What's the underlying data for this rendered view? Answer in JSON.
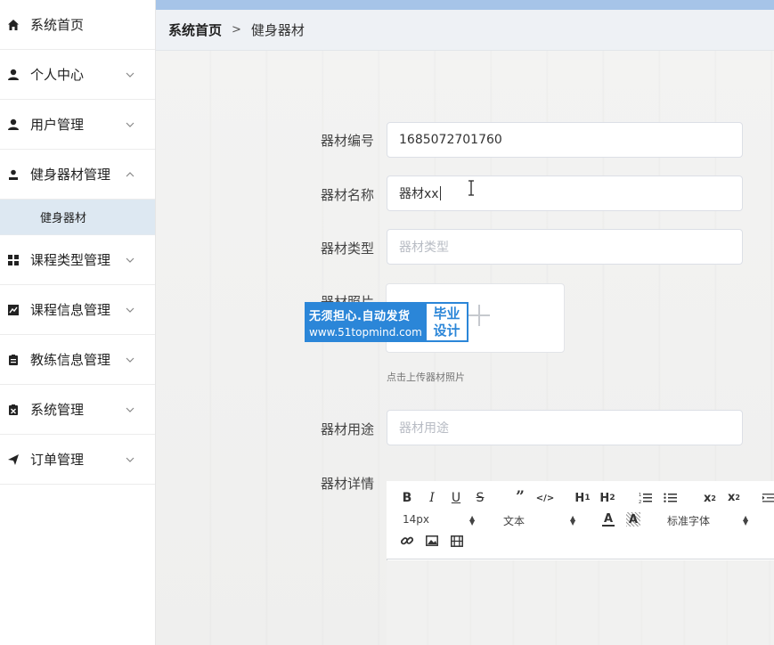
{
  "sidebar": {
    "items": [
      {
        "label": "系统首页",
        "icon": "home-icon",
        "expandable": false
      },
      {
        "label": "个人中心",
        "icon": "person-icon",
        "expandable": true
      },
      {
        "label": "用户管理",
        "icon": "person-icon",
        "expandable": true
      },
      {
        "label": "健身器材管理",
        "icon": "person-small-icon",
        "expandable": true,
        "expanded": true
      },
      {
        "label": "课程类型管理",
        "icon": "grid-icon",
        "expandable": true
      },
      {
        "label": "课程信息管理",
        "icon": "chart-icon",
        "expandable": true
      },
      {
        "label": "教练信息管理",
        "icon": "clipboard-icon",
        "expandable": true
      },
      {
        "label": "系统管理",
        "icon": "clipboard-x-icon",
        "expandable": true
      },
      {
        "label": "订单管理",
        "icon": "send-icon",
        "expandable": true
      }
    ],
    "subitem": {
      "label": "健身器材"
    }
  },
  "breadcrumb": {
    "home": "系统首页",
    "separator": ">",
    "current": "健身器材"
  },
  "form": {
    "code": {
      "label": "器材编号",
      "value": "1685072701760"
    },
    "name": {
      "label": "器材名称",
      "value": "器材xx"
    },
    "type": {
      "label": "器材类型",
      "placeholder": "器材类型"
    },
    "photo": {
      "label": "器材照片",
      "hint": "点击上传器材照片"
    },
    "usage": {
      "label": "器材用途",
      "placeholder": "器材用途"
    },
    "detail": {
      "label": "器材详情"
    }
  },
  "editor": {
    "font_size": "14px",
    "block_type": "文本",
    "font_family": "标准字体"
  },
  "watermark": {
    "line1": "无须担心.自动发货",
    "line2": "www.51topmind.com",
    "badge1": "毕业",
    "badge2": "设计"
  },
  "colors": {
    "topbar": "#a6c4e8",
    "submenu_bg": "#dde8f2",
    "watermark_blue": "#2b86d8"
  }
}
